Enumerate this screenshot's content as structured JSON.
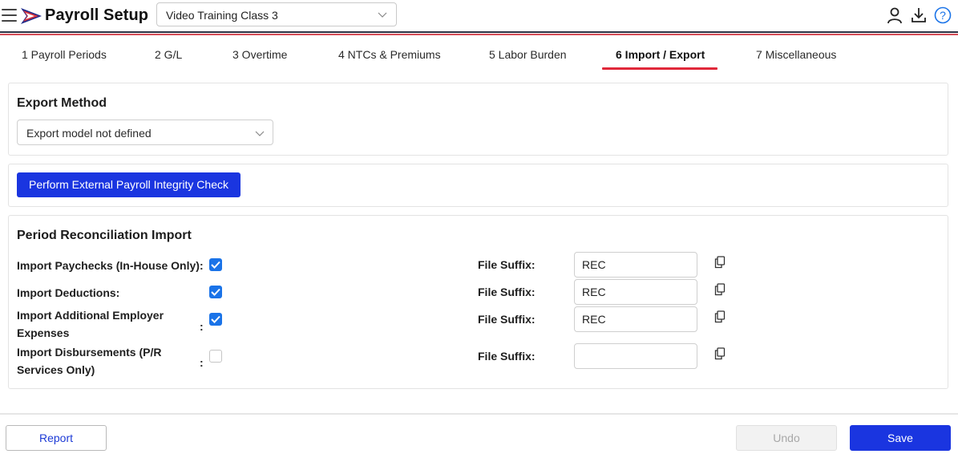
{
  "header": {
    "title": "Payroll Setup",
    "class_select": {
      "value": "Video Training Class 3"
    },
    "icons": [
      "menu-icon",
      "logo-flag-icon",
      "user-icon",
      "download-icon",
      "help-icon"
    ]
  },
  "tabs": [
    {
      "label": "1 Payroll Periods",
      "active": false
    },
    {
      "label": "2 G/L",
      "active": false
    },
    {
      "label": "3 Overtime",
      "active": false
    },
    {
      "label": "4 NTCs & Premiums",
      "active": false
    },
    {
      "label": "5 Labor Burden",
      "active": false
    },
    {
      "label": "6 Import / Export",
      "active": true
    },
    {
      "label": "7 Miscellaneous",
      "active": false
    }
  ],
  "export_method": {
    "title": "Export Method",
    "select_value": "Export model not defined"
  },
  "integrity_check": {
    "button_label": "Perform External Payroll Integrity Check"
  },
  "reconciliation": {
    "title": "Period Reconciliation Import",
    "rows": [
      {
        "label": "Import Paychecks (In-House Only):",
        "checked": true,
        "suffix_label": "File Suffix:",
        "suffix_value": "REC"
      },
      {
        "label": "Import Deductions:",
        "checked": true,
        "suffix_label": "File Suffix:",
        "suffix_value": "REC"
      },
      {
        "label_line1": "Import Additional Employer",
        "label_line2": "Expenses",
        "colon": ":",
        "checked": true,
        "suffix_label": "File Suffix:",
        "suffix_value": "REC"
      },
      {
        "label_line1": "Import Disbursements (P/R",
        "label_line2": "Services Only)",
        "colon": ":",
        "checked": false,
        "suffix_label": "File Suffix:",
        "suffix_value": ""
      }
    ]
  },
  "footer": {
    "report_label": "Report",
    "undo_label": "Undo",
    "save_label": "Save"
  },
  "colors": {
    "primary": "#1a35e0",
    "checkbox": "#1a73e8",
    "tab_accent": "#e0283a",
    "help_icon": "#1a73e8"
  }
}
